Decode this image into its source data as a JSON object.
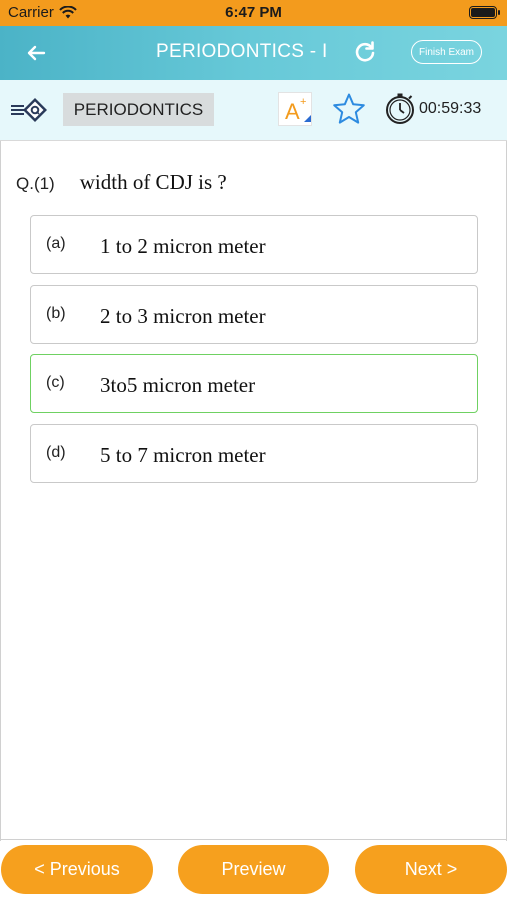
{
  "status_bar": {
    "carrier": "Carrier",
    "time": "6:47 PM",
    "wifi_icon": "wifi-icon",
    "battery_icon": "battery-icon"
  },
  "header": {
    "back_icon": "arrow-left-icon",
    "title": "PERIODONTICS - I",
    "refresh_icon": "refresh-icon",
    "finish_label": "Finish Exam",
    "accent_color": "#5bc0d0"
  },
  "toolbar": {
    "subject": "PERIODONTICS",
    "font_button_label": "A",
    "font_button_sup": "+",
    "timer": "00:59:33"
  },
  "question": {
    "number": "Q.(1)",
    "text": "width of CDJ is ?",
    "options": [
      {
        "letter": "(a)",
        "text": "1 to 2 micron meter",
        "selected": false
      },
      {
        "letter": "(b)",
        "text": "2 to 3 micron meter",
        "selected": false
      },
      {
        "letter": "(c)",
        "text": "3to5 micron meter",
        "selected": true
      },
      {
        "letter": "(d)",
        "text": "5 to 7 micron meter",
        "selected": false
      }
    ],
    "selected_color": "#6fd162"
  },
  "footer": {
    "previous_label": "< Previous",
    "preview_label": "Preview",
    "next_label": "Next >",
    "button_color": "#f6a01e"
  }
}
